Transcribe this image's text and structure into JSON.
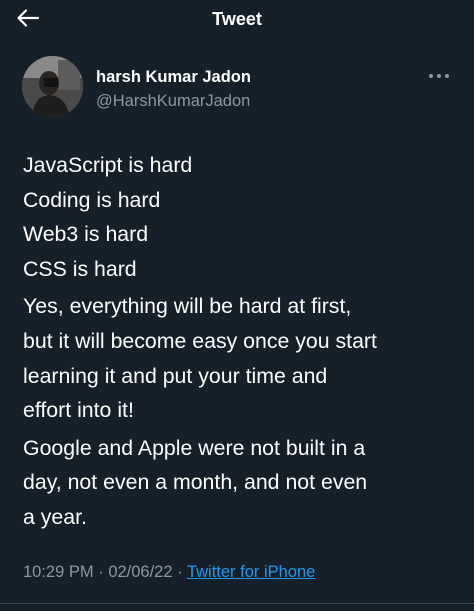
{
  "header": {
    "title": "Tweet",
    "back_icon": "arrow-left-icon"
  },
  "author": {
    "name": "harsh Kumar Jadon",
    "handle": "@HarshKumarJadon",
    "more_icon": "more-horizontal-icon"
  },
  "tweet": {
    "paragraphs": [
      "JavaScript is hard\nCoding is hard\nWeb3 is hard\nCSS is hard",
      "Yes, everything will be hard at first,\nbut it will become easy once you start\nlearning it and put your time and\neffort into it!",
      "Google and Apple were not built in a\nday, not even a month, and not even\na year."
    ],
    "time": "10:29 PM",
    "separator": "·",
    "date": "02/06/22",
    "source": "Twitter for iPhone"
  },
  "colors": {
    "background": "#15202b",
    "secondary_text": "#8b98a5",
    "link": "#1d9bf0"
  }
}
